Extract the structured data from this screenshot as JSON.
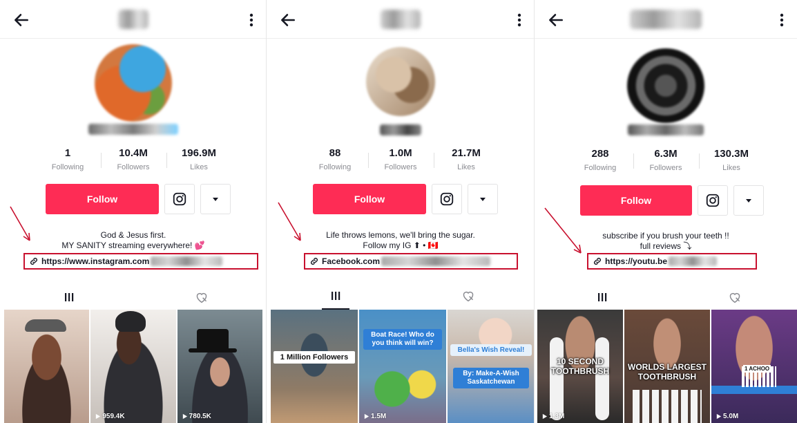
{
  "profiles": [
    {
      "stats": [
        {
          "value": "1",
          "label": "Following"
        },
        {
          "value": "10.4M",
          "label": "Followers"
        },
        {
          "value": "196.9M",
          "label": "Likes"
        }
      ],
      "follow_label": "Follow",
      "bio_lines": [
        "God & Jesus first.",
        "MY SANITY streaming everywhere! 💕"
      ],
      "link_text": "https://www.instagram.com",
      "videos": [
        {
          "count": "",
          "overlay": ""
        },
        {
          "count": "959.4K",
          "overlay": ""
        },
        {
          "count": "780.5K",
          "overlay": ""
        }
      ]
    },
    {
      "stats": [
        {
          "value": "88",
          "label": "Following"
        },
        {
          "value": "1.0M",
          "label": "Followers"
        },
        {
          "value": "21.7M",
          "label": "Likes"
        }
      ],
      "follow_label": "Follow",
      "bio_lines": [
        "Life throws lemons, we'll bring the sugar.",
        "Follow my IG ⬆ • 🇨🇦"
      ],
      "link_text": "Facebook.com",
      "videos": [
        {
          "count": "",
          "overlay": "1 Million Followers"
        },
        {
          "count": "1.5M",
          "overlay": "Boat Race! Who do you think will win?"
        },
        {
          "count": "",
          "overlay": "Bella's Wish Reveal!",
          "overlay2": "By: Make-A-Wish Saskatchewan"
        }
      ]
    },
    {
      "stats": [
        {
          "value": "288",
          "label": "Following"
        },
        {
          "value": "6.3M",
          "label": "Followers"
        },
        {
          "value": "130.3M",
          "label": "Likes"
        }
      ],
      "follow_label": "Follow",
      "bio_lines": [
        "subscribe if you brush your teeth !!",
        "full reviews ⤵"
      ],
      "link_text": "https://youtu.be",
      "videos": [
        {
          "count": "1.3M",
          "overlay": "10 SECOND TOOTHBRUSH"
        },
        {
          "count": "",
          "overlay": "WORLDS LARGEST TOOTHBRUSH"
        },
        {
          "count": "5.0M",
          "overlay": "1 ACHOO"
        }
      ]
    }
  ],
  "colors": {
    "follow": "#fe2c55",
    "highlight_box": "#c8102e",
    "arrow": "#c8102e"
  },
  "icons": {
    "back": "back-arrow-icon",
    "more": "more-vertical-icon",
    "instagram": "instagram-icon",
    "dropdown": "caret-down-icon",
    "link": "link-icon",
    "videos_tab": "grid-videos-icon",
    "liked_tab": "liked-heart-icon",
    "play": "play-icon"
  }
}
